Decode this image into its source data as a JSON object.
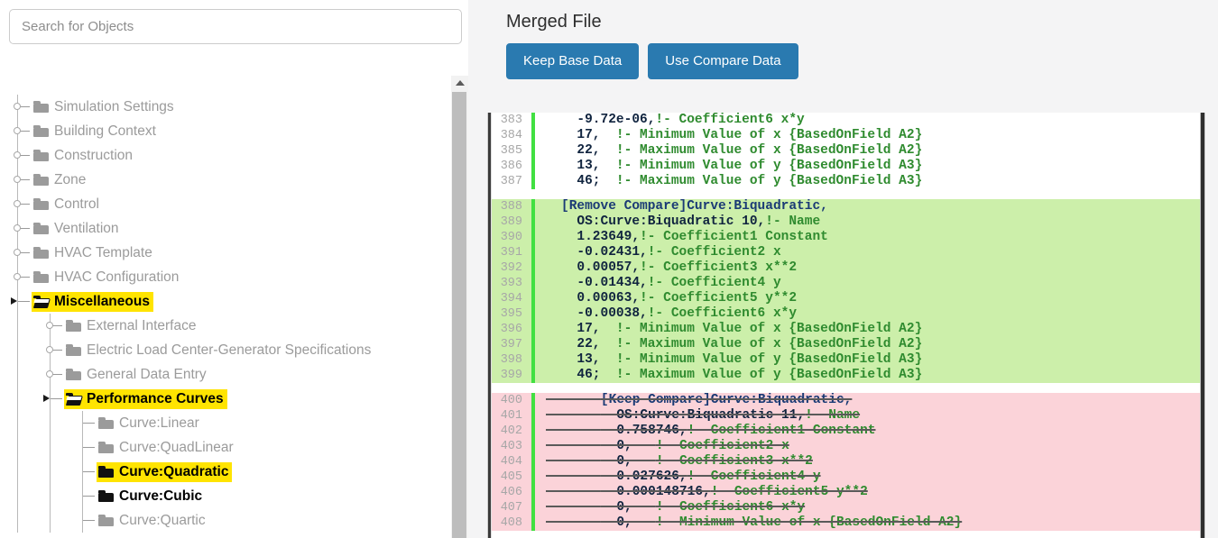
{
  "search": {
    "placeholder": "Search for Objects",
    "value": ""
  },
  "tree": {
    "items": [
      {
        "label": "Simulation Settings",
        "depth": 0,
        "icon": "folder-closed-icon",
        "state": "normal",
        "expander": "knob"
      },
      {
        "label": "Building Context",
        "depth": 0,
        "icon": "folder-closed-icon",
        "state": "normal",
        "expander": "knob"
      },
      {
        "label": "Construction",
        "depth": 0,
        "icon": "folder-closed-icon",
        "state": "normal",
        "expander": "knob"
      },
      {
        "label": "Zone",
        "depth": 0,
        "icon": "folder-closed-icon",
        "state": "normal",
        "expander": "knob"
      },
      {
        "label": "Control",
        "depth": 0,
        "icon": "folder-closed-icon",
        "state": "normal",
        "expander": "knob"
      },
      {
        "label": "Ventilation",
        "depth": 0,
        "icon": "folder-closed-icon",
        "state": "normal",
        "expander": "knob"
      },
      {
        "label": "HVAC Template",
        "depth": 0,
        "icon": "folder-closed-icon",
        "state": "normal",
        "expander": "knob"
      },
      {
        "label": "HVAC Configuration",
        "depth": 0,
        "icon": "folder-closed-icon",
        "state": "normal",
        "expander": "knob"
      },
      {
        "label": "Miscellaneous",
        "depth": 0,
        "icon": "folder-open-icon",
        "state": "highlighted",
        "expander": "caret-expanded"
      },
      {
        "label": "External Interface",
        "depth": 1,
        "icon": "folder-closed-icon",
        "state": "normal",
        "expander": "knob"
      },
      {
        "label": "Electric Load Center-Generator Specifications",
        "depth": 1,
        "icon": "folder-closed-icon",
        "state": "normal",
        "expander": "knob"
      },
      {
        "label": "General Data Entry",
        "depth": 1,
        "icon": "folder-closed-icon",
        "state": "normal",
        "expander": "knob"
      },
      {
        "label": "Performance Curves",
        "depth": 1,
        "icon": "folder-open-icon",
        "state": "highlighted",
        "expander": "caret-expanded"
      },
      {
        "label": "Curve:Linear",
        "depth": 2,
        "icon": "folder-closed-icon",
        "state": "normal",
        "expander": "dash"
      },
      {
        "label": "Curve:QuadLinear",
        "depth": 2,
        "icon": "folder-closed-icon",
        "state": "normal",
        "expander": "dash"
      },
      {
        "label": "Curve:Quadratic",
        "depth": 2,
        "icon": "folder-closed-dark-icon",
        "state": "highlighted",
        "expander": "dash"
      },
      {
        "label": "Curve:Cubic",
        "depth": 2,
        "icon": "folder-closed-dark-icon",
        "state": "dark",
        "expander": "dash"
      },
      {
        "label": "Curve:Quartic",
        "depth": 2,
        "icon": "folder-closed-icon",
        "state": "normal",
        "expander": "dash"
      }
    ]
  },
  "merged": {
    "title": "Merged File",
    "keep_base_label": "Keep Base Data",
    "use_compare_label": "Use Compare Data"
  },
  "colors": {
    "accent_button": "#2a7ab0",
    "highlight": "#ffe400",
    "added_bg": "#ccefaa",
    "deleted_bg": "#fbd3d9",
    "gutter_stripe": "#41e041",
    "comment_text": "#2f8b2f"
  },
  "diff": {
    "hunks": [
      {
        "kind": "context",
        "lines": [
          {
            "n": "383",
            "text": "  -9.72e-06,!- Coefficient6 x*y"
          },
          {
            "n": "384",
            "text": "  17,  !- Minimum Value of x {BasedOnField A2}"
          },
          {
            "n": "385",
            "text": "  22,  !- Maximum Value of x {BasedOnField A2}"
          },
          {
            "n": "386",
            "text": "  13,  !- Minimum Value of y {BasedOnField A3}"
          },
          {
            "n": "387",
            "text": "  46;  !- Maximum Value of y {BasedOnField A3}"
          }
        ]
      },
      {
        "kind": "added",
        "lines": [
          {
            "n": "388",
            "text": "[Remove Compare]Curve:Biquadratic,"
          },
          {
            "n": "389",
            "text": "  OS:Curve:Biquadratic 10,!- Name"
          },
          {
            "n": "390",
            "text": "  1.23649,!- Coefficient1 Constant"
          },
          {
            "n": "391",
            "text": "  -0.02431,!- Coefficient2 x"
          },
          {
            "n": "392",
            "text": "  0.00057,!- Coefficient3 x**2"
          },
          {
            "n": "393",
            "text": "  -0.01434,!- Coefficient4 y"
          },
          {
            "n": "394",
            "text": "  0.00063,!- Coefficient5 y**2"
          },
          {
            "n": "395",
            "text": "  -0.00038,!- Coefficient6 x*y"
          },
          {
            "n": "396",
            "text": "  17,  !- Minimum Value of x {BasedOnField A2}"
          },
          {
            "n": "397",
            "text": "  22,  !- Maximum Value of x {BasedOnField A2}"
          },
          {
            "n": "398",
            "text": "  13,  !- Minimum Value of y {BasedOnField A3}"
          },
          {
            "n": "399",
            "text": "  46;  !- Maximum Value of y {BasedOnField A3}"
          }
        ]
      },
      {
        "kind": "deleted",
        "lines": [
          {
            "n": "400",
            "text": "[Keep Compare]Curve:Biquadratic,"
          },
          {
            "n": "401",
            "text": "  OS:Curve:Biquadratic 11,!- Name"
          },
          {
            "n": "402",
            "text": "  0.758746,!- Coefficient1 Constant"
          },
          {
            "n": "403",
            "text": "  0,   !- Coefficient2 x"
          },
          {
            "n": "404",
            "text": "  0,   !- Coefficient3 x**2"
          },
          {
            "n": "405",
            "text": "  0.027626,!- Coefficient4 y"
          },
          {
            "n": "406",
            "text": "  0.000148716,!- Coefficient5 y**2"
          },
          {
            "n": "407",
            "text": "  0,   !- Coefficient6 x*y"
          },
          {
            "n": "408",
            "text": "  0,   !- Minimum Value of x {BasedOnField A2}"
          }
        ]
      }
    ]
  }
}
